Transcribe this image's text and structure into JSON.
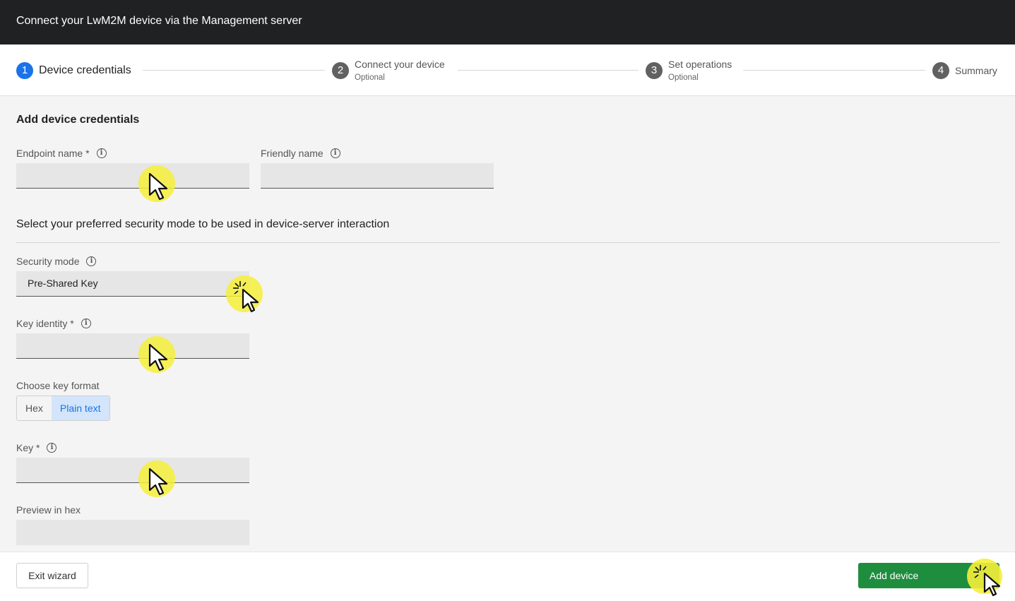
{
  "window": {
    "title": "Connect your LwM2M device via the Management server"
  },
  "stepper": {
    "steps": [
      {
        "number": "1",
        "label": "Device credentials",
        "sub": ""
      },
      {
        "number": "2",
        "label": "Connect your device",
        "sub": "Optional"
      },
      {
        "number": "3",
        "label": "Set operations",
        "sub": "Optional"
      },
      {
        "number": "4",
        "label": "Summary",
        "sub": ""
      }
    ],
    "active_step": 1
  },
  "form": {
    "section_title": "Add device credentials",
    "endpoint_name": {
      "label": "Endpoint name *",
      "value": ""
    },
    "friendly_name": {
      "label": "Friendly name",
      "value": ""
    },
    "security_heading": "Select your preferred security mode to be used in device-server interaction",
    "security_mode": {
      "label": "Security mode",
      "value": "Pre-Shared Key"
    },
    "key_identity": {
      "label": "Key identity *",
      "value": ""
    },
    "key_format": {
      "label": "Choose key format",
      "options": [
        "Hex",
        "Plain text"
      ],
      "selected": "Plain text"
    },
    "key": {
      "label": "Key *",
      "value": ""
    },
    "preview_hex": {
      "label": "Preview in hex",
      "value": ""
    }
  },
  "footer": {
    "exit_label": "Exit wizard",
    "add_label": "Add device"
  },
  "icons": {
    "info": "info-icon",
    "cursor": "cursor-pointer-icon"
  },
  "colors": {
    "titlebar": "#1f2123",
    "accent": "#1a73e8",
    "primary_button": "#1e8e3e",
    "highlight": "#f5ee3a"
  }
}
